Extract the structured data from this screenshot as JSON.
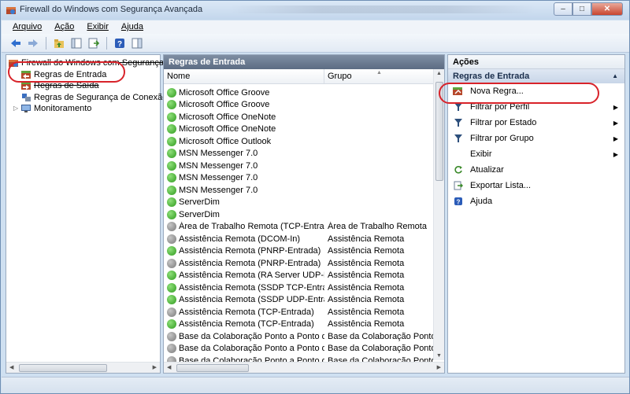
{
  "window": {
    "title": "Firewall do Windows com Segurança Avançada",
    "controls": {
      "minimize": "–",
      "maximize": "□",
      "close": "✕"
    }
  },
  "menu": [
    "Arquivo",
    "Ação",
    "Exibir",
    "Ajuda"
  ],
  "tree": {
    "root": "Firewall do Windows com Segurança Ava...",
    "items": [
      "Regras de Entrada",
      "Regras de Saída",
      "Regras de Segurança de Conexão",
      "Monitoramento"
    ]
  },
  "list": {
    "header": "Regras de Entrada",
    "columns": [
      "Nome",
      "Grupo"
    ],
    "rows": [
      {
        "name": "Microsoft Office Groove",
        "group": "",
        "enabled": true
      },
      {
        "name": "Microsoft Office Groove",
        "group": "",
        "enabled": true
      },
      {
        "name": "Microsoft Office OneNote",
        "group": "",
        "enabled": true
      },
      {
        "name": "Microsoft Office OneNote",
        "group": "",
        "enabled": true
      },
      {
        "name": "Microsoft Office Outlook",
        "group": "",
        "enabled": true
      },
      {
        "name": "MSN Messenger 7.0",
        "group": "",
        "enabled": true
      },
      {
        "name": "MSN Messenger 7.0",
        "group": "",
        "enabled": true
      },
      {
        "name": "MSN Messenger 7.0",
        "group": "",
        "enabled": true
      },
      {
        "name": "MSN Messenger 7.0",
        "group": "",
        "enabled": true
      },
      {
        "name": "ServerDim",
        "group": "",
        "enabled": true
      },
      {
        "name": "ServerDim",
        "group": "",
        "enabled": true
      },
      {
        "name": "Área de Trabalho Remota (TCP-Entrada)",
        "group": "Área de Trabalho Remota",
        "enabled": false
      },
      {
        "name": "Assistência Remota (DCOM-In)",
        "group": "Assistência Remota",
        "enabled": false
      },
      {
        "name": "Assistência Remota (PNRP-Entrada)",
        "group": "Assistência Remota",
        "enabled": true
      },
      {
        "name": "Assistência Remota (PNRP-Entrada)",
        "group": "Assistência Remota",
        "enabled": false
      },
      {
        "name": "Assistência Remota (RA Server UDP-Entra...",
        "group": "Assistência Remota",
        "enabled": true
      },
      {
        "name": "Assistência Remota (SSDP TCP-Entrada)",
        "group": "Assistência Remota",
        "enabled": true
      },
      {
        "name": "Assistência Remota (SSDP UDP-Entrada)",
        "group": "Assistência Remota",
        "enabled": true
      },
      {
        "name": "Assistência Remota (TCP-Entrada)",
        "group": "Assistência Remota",
        "enabled": false
      },
      {
        "name": "Assistência Remota (TCP-Entrada)",
        "group": "Assistência Remota",
        "enabled": true
      },
      {
        "name": "Base da Colaboração Ponto a Ponto do ...",
        "group": "Base da Colaboração Ponto ...",
        "enabled": false
      },
      {
        "name": "Base da Colaboração Ponto a Ponto do ...",
        "group": "Base da Colaboração Ponto ...",
        "enabled": false
      },
      {
        "name": "Base da Colaboração Ponto a Ponto do ...",
        "group": "Base da Colaboração Ponto ...",
        "enabled": false
      }
    ]
  },
  "actions": {
    "title": "Ações",
    "section": "Regras de Entrada",
    "items": [
      {
        "label": "Nova Regra...",
        "icon": "new-rule-icon",
        "submenu": false
      },
      {
        "label": "Filtrar por Perfil",
        "icon": "filter-icon",
        "submenu": true
      },
      {
        "label": "Filtrar por Estado",
        "icon": "filter-icon",
        "submenu": true
      },
      {
        "label": "Filtrar por Grupo",
        "icon": "filter-icon",
        "submenu": true
      },
      {
        "label": "Exibir",
        "icon": "",
        "submenu": true
      },
      {
        "label": "Atualizar",
        "icon": "refresh-icon",
        "submenu": false
      },
      {
        "label": "Exportar Lista...",
        "icon": "export-icon",
        "submenu": false
      },
      {
        "label": "Ajuda",
        "icon": "help-icon",
        "submenu": false
      }
    ]
  },
  "colors": {
    "annotation": "#d8232a",
    "pane_header": "#6b7a90",
    "enabled": "#2f9a1e",
    "disabled": "#7a7a7a"
  }
}
